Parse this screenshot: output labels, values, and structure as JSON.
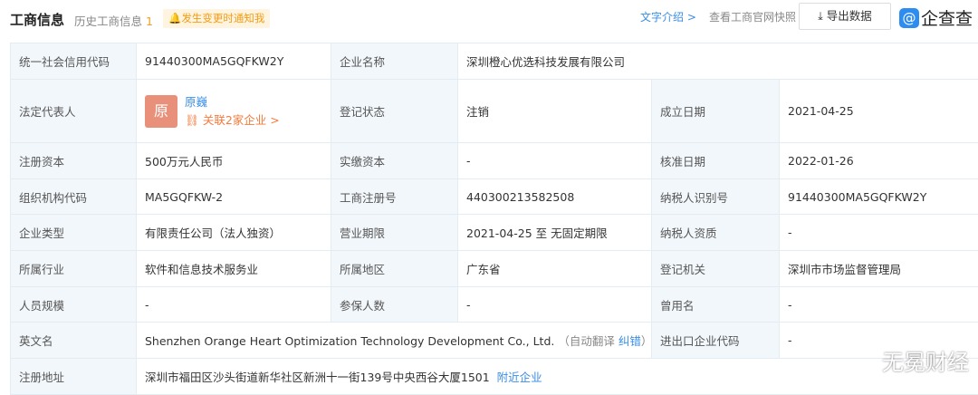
{
  "header": {
    "title": "工商信息",
    "history_label": "历史工商信息",
    "history_count": "1",
    "notify": "发生变更时通知我",
    "intro_link": "文字介绍 >",
    "snapshot": "查看工商官网快照",
    "export": "导出数据",
    "logo_text": "企查查"
  },
  "table": {
    "credit_code_label": "统一社会信用代码",
    "credit_code": "91440300MA5GQFKW2Y",
    "name_label": "企业名称",
    "name": "深圳橙心优选科技发展有限公司",
    "legal_label": "法定代表人",
    "legal_avatar": "原",
    "legal_name": "原巍",
    "legal_related": "关联2家企业 >",
    "status_label": "登记状态",
    "status": "注销",
    "found_label": "成立日期",
    "found": "2021-04-25",
    "capital_label": "注册资本",
    "capital": "500万元人民币",
    "paid_label": "实缴资本",
    "paid": "-",
    "approve_label": "核准日期",
    "approve": "2022-01-26",
    "org_label": "组织机构代码",
    "org": "MA5GQFKW-2",
    "reg_no_label": "工商注册号",
    "reg_no": "440300213582508",
    "tax_label": "纳税人识别号",
    "tax": "91440300MA5GQFKW2Y",
    "type_label": "企业类型",
    "type": "有限责任公司（法人独资）",
    "term_label": "营业期限",
    "term": "2021-04-25 至 无固定期限",
    "taxq_label": "纳税人资质",
    "taxq": "-",
    "industry_label": "所属行业",
    "industry": "软件和信息技术服务业",
    "region_label": "所属地区",
    "region": "广东省",
    "authority_label": "登记机关",
    "authority": "深圳市市场监督管理局",
    "staff_label": "人员规模",
    "staff": "-",
    "insured_label": "参保人数",
    "insured": "-",
    "former_label": "曾用名",
    "former": "-",
    "en_label": "英文名",
    "en": "Shenzhen Orange Heart Optimization Technology Development Co., Ltd.",
    "en_auto": "（自动翻译",
    "en_fix": "纠错",
    "en_close": "）",
    "ie_label": "进出口企业代码",
    "ie": "-",
    "addr_label": "注册地址",
    "addr": "深圳市福田区沙头街道新华社区新洲十一街139号中央西谷大厦1501",
    "addr_nearby": "附近企业"
  },
  "watermark": "无冕财经"
}
